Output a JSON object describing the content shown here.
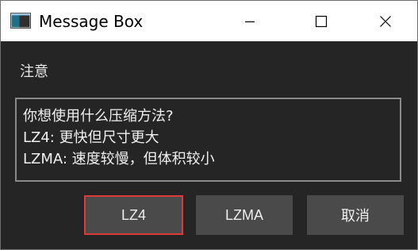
{
  "window": {
    "title": "Message Box",
    "controls": {
      "minimize_icon": "minimize-icon",
      "maximize_icon": "maximize-icon",
      "close_icon": "close-icon"
    },
    "app_icon": "window-app-icon"
  },
  "dialog": {
    "header": "注意",
    "message_lines": [
      "你想使用什么压缩方法?",
      "LZ4: 更快但尺寸更大",
      "LZMA: 速度较慢，但体积较小"
    ],
    "buttons": {
      "lz4": "LZ4",
      "lzma": "LZMA",
      "cancel": "取消"
    },
    "focused_button_color": "#e0393b"
  },
  "colors": {
    "background": "#252525",
    "button": "#4a4a4a",
    "text": "#f0f0f0",
    "titlebar": "#ffffff"
  }
}
